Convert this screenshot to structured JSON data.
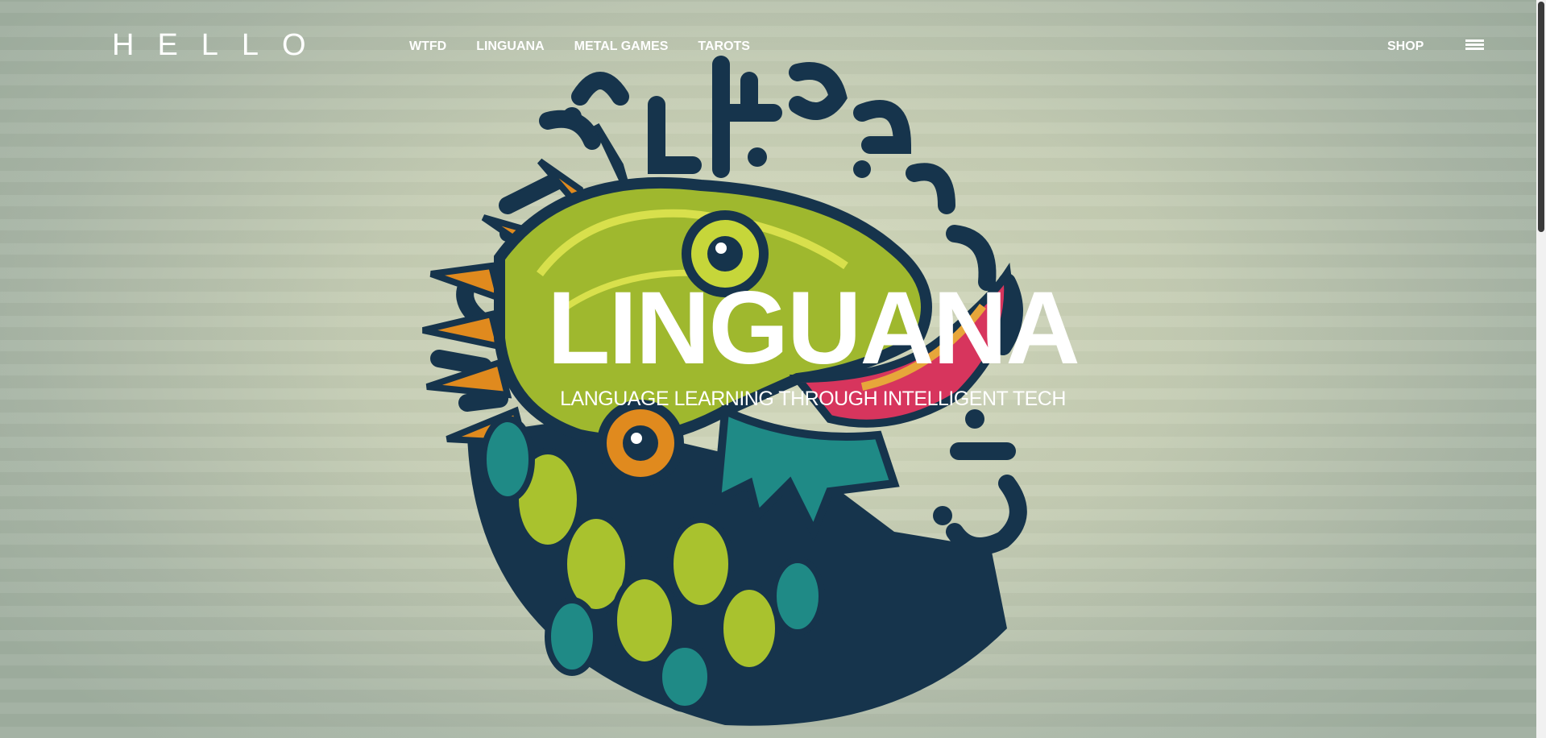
{
  "header": {
    "logo_text": "HELLO",
    "nav": [
      {
        "label": "WTFD"
      },
      {
        "label": "LINGUANA"
      },
      {
        "label": "METAL GAMES"
      },
      {
        "label": "TAROTS"
      }
    ],
    "shop_label": "SHOP",
    "menu_icon": "hamburger-menu-icon"
  },
  "hero": {
    "title": "LINGUANA",
    "subtitle": "LANGUAGE LEARNING THROUGH INTELLIGENT TECH",
    "image": "iguana-glyph-illustration"
  },
  "colors": {
    "background": "#c4ccb3",
    "text": "#ffffff",
    "navy": "#14324a",
    "lime": "#b5c93a",
    "teal": "#1f8a86",
    "orange": "#e08a1e",
    "red": "#d7355d"
  }
}
